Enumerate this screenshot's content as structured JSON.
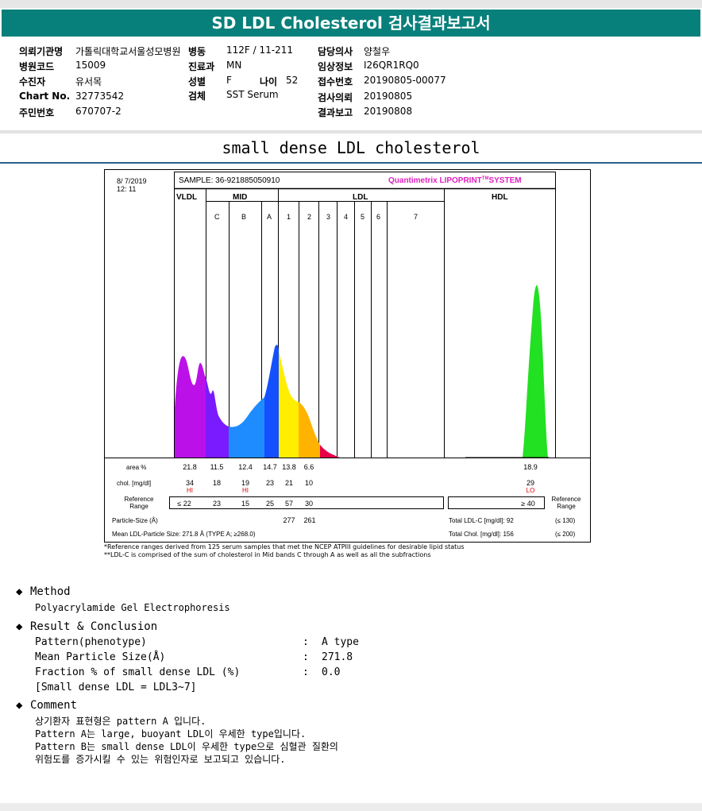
{
  "header": {
    "title": "SD LDL Cholesterol 검사결과보고서"
  },
  "info": {
    "hospital_label": "의뢰기관명",
    "hospital_value": "가톨릭대학교서울성모병원",
    "ward_label": "병동",
    "ward_value": "112F / 11-211",
    "doctor_label": "담당의사",
    "doctor_value": "양철우",
    "code_label": "병원코드",
    "code_value": "15009",
    "dept_label": "진료과",
    "dept_value": "MN",
    "clinical_label": "임상정보",
    "clinical_value": "I26QR1RQ0",
    "patient_label": "수진자",
    "patient_value": "유서목",
    "sex_label": "성별",
    "sex_value": "F",
    "age_label": "나이",
    "age_value": "52",
    "receipt_label": "접수번호",
    "receipt_value": "20190805-00077",
    "chart_label": "Chart No.",
    "chart_value": "32773542",
    "specimen_label": "검체",
    "specimen_value": "SST Serum",
    "request_label": "검사의뢰",
    "request_value": "20190805",
    "id_label": "주민번호",
    "id_value": "670707-2",
    "report_label": "결과보고",
    "report_value": "20190808"
  },
  "subtitle": "small dense LDL cholesterol",
  "report": {
    "date": "8/ 7/2019",
    "time": "12: 11",
    "sample": "SAMPLE:  36-921885050910",
    "brand": "Quantimetrix LIPOPRINT",
    "brand_tm": "TM",
    "brand_suffix": "SYSTEM",
    "groups": [
      "VLDL",
      "MID",
      "LDL",
      "HDL"
    ],
    "bands": [
      "C",
      "B",
      "A",
      "1",
      "2",
      "3",
      "4",
      "5",
      "6",
      "7"
    ],
    "area_label": "area %",
    "area_values": [
      "21.8",
      "11.5",
      "12.4",
      "14.7",
      "13.8",
      "6.6"
    ],
    "area_hdl": "18.9",
    "chol_label": "chol. [mg/dl]",
    "chol_values": [
      "34",
      "18",
      "19",
      "23",
      "21",
      "10"
    ],
    "chol_flags": [
      "HI",
      "",
      "HI",
      "",
      "",
      ""
    ],
    "chol_hdl": "29",
    "chol_hdl_flag": "LO",
    "ref_label_1": "Reference",
    "ref_label_2": "Range",
    "ref_values": [
      "≤ 22",
      "23",
      "15",
      "25",
      "57",
      "30"
    ],
    "ref_hdl": "≥ 40",
    "particle_label": "Particle-Size (Å)",
    "particle_values": [
      "277",
      "261"
    ],
    "mean_label": "Mean LDL-Particle Size:  271.8 Å  (TYPE A; ≥268.0)",
    "total_ldl": "Total LDL-C [mg/dl]:  92",
    "total_ldl_ref": "(≤ 130)",
    "total_chol": "Total Chol. [mg/dl]:  156",
    "total_chol_ref": "(≤ 200)"
  },
  "notes": {
    "line1": "*Reference ranges derived from 125 serum samples that met the NCEP ATPIII guidelines for desirable lipid status",
    "line2": "**LDL-C is comprised of the sum of cholesterol in Mid bands C through A as well as all the subfractions"
  },
  "method": {
    "title": "Method",
    "text": "Polyacrylamide Gel Electrophoresis"
  },
  "result": {
    "title": "Result & Conclusion",
    "rows": [
      {
        "label": "Pattern(phenotype)",
        "colon": ":",
        "value": "A type"
      },
      {
        "label": "Mean Particle Size(Å)",
        "colon": ":",
        "value": "271.8"
      },
      {
        "label": "Fraction % of small dense LDL (%)",
        "colon": ":",
        "value": "0.0"
      }
    ],
    "footnote": "[Small dense LDL = LDL3~7]"
  },
  "comment": {
    "title": "Comment",
    "lines": [
      "상기환자 표현형은 pattern A 입니다.",
      "Pattern A는 large, buoyant LDL이 우세한 type입니다.",
      "Pattern B는 small dense LDL이 우세한 type으로 심혈관 질환의",
      "위험도를 증가시킬 수 있는 위험인자로 보고되고 있습니다."
    ]
  },
  "colors": {
    "header_bg": "#077f7a",
    "vldl": "#bb10e8",
    "mid_c": "#7a1aff",
    "mid_b": "#1e8cff",
    "mid_a": "#1450ff",
    "ldl1": "#ffee00",
    "ldl2": "#ffb300",
    "ldl3": "#e8004a",
    "hdl": "#22e022",
    "brand": "#e020c0",
    "flag": "#e00000"
  }
}
